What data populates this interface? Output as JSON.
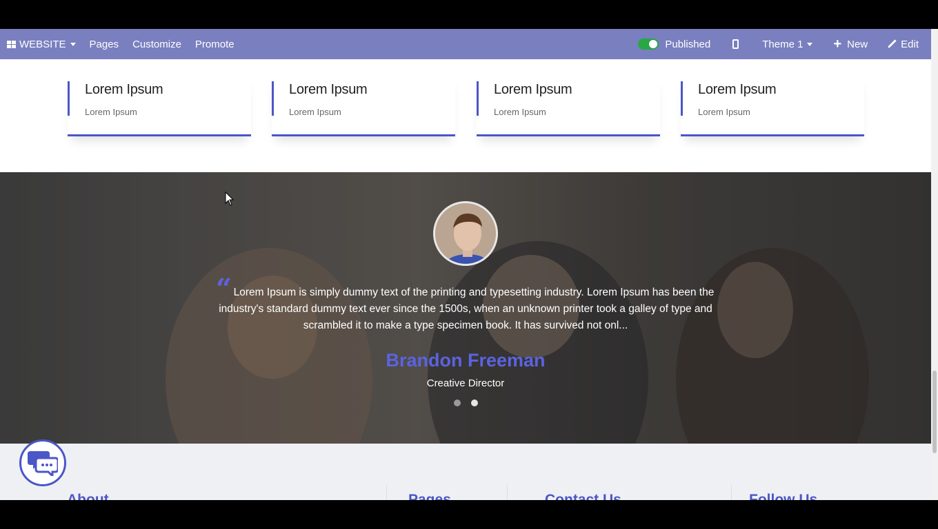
{
  "topbar": {
    "website_label": "WEBSITE",
    "pages_label": "Pages",
    "customize_label": "Customize",
    "promote_label": "Promote",
    "published_label": "Published",
    "theme_label": "Theme 1",
    "new_label": "New",
    "edit_label": "Edit"
  },
  "cards": [
    {
      "title": "Lorem Ipsum",
      "subtitle": "Lorem Ipsum"
    },
    {
      "title": "Lorem Ipsum",
      "subtitle": "Lorem Ipsum"
    },
    {
      "title": "Lorem Ipsum",
      "subtitle": "Lorem Ipsum"
    },
    {
      "title": "Lorem Ipsum",
      "subtitle": "Lorem Ipsum"
    }
  ],
  "testimonial": {
    "quote": "Lorem Ipsum is simply dummy text of the printing and typesetting industry. Lorem Ipsum has been the industry's standard dummy text ever since the 1500s, when an unknown printer took a galley of type and scrambled it to make a type specimen book. It has survived not onl...",
    "author": "Brandon Freeman",
    "role": "Creative Director",
    "slide_count": 2,
    "active_slide": 2
  },
  "footer": {
    "about_label": "About",
    "pages_label": "Pages",
    "contact_label": "Contact Us",
    "follow_label": "Follow Us"
  },
  "colors": {
    "topbar": "#7a7fbf",
    "accent": "#4b56c7",
    "author": "#5b63e0",
    "toggle_on": "#28a745",
    "footer_bg": "#eff0f4"
  },
  "icons": {
    "apps": "grid-icon",
    "device": "mobile-phone-icon",
    "new": "plus-icon",
    "edit": "pencil-icon",
    "quote": "quote-icon",
    "chat": "chat-bubbles-icon"
  }
}
